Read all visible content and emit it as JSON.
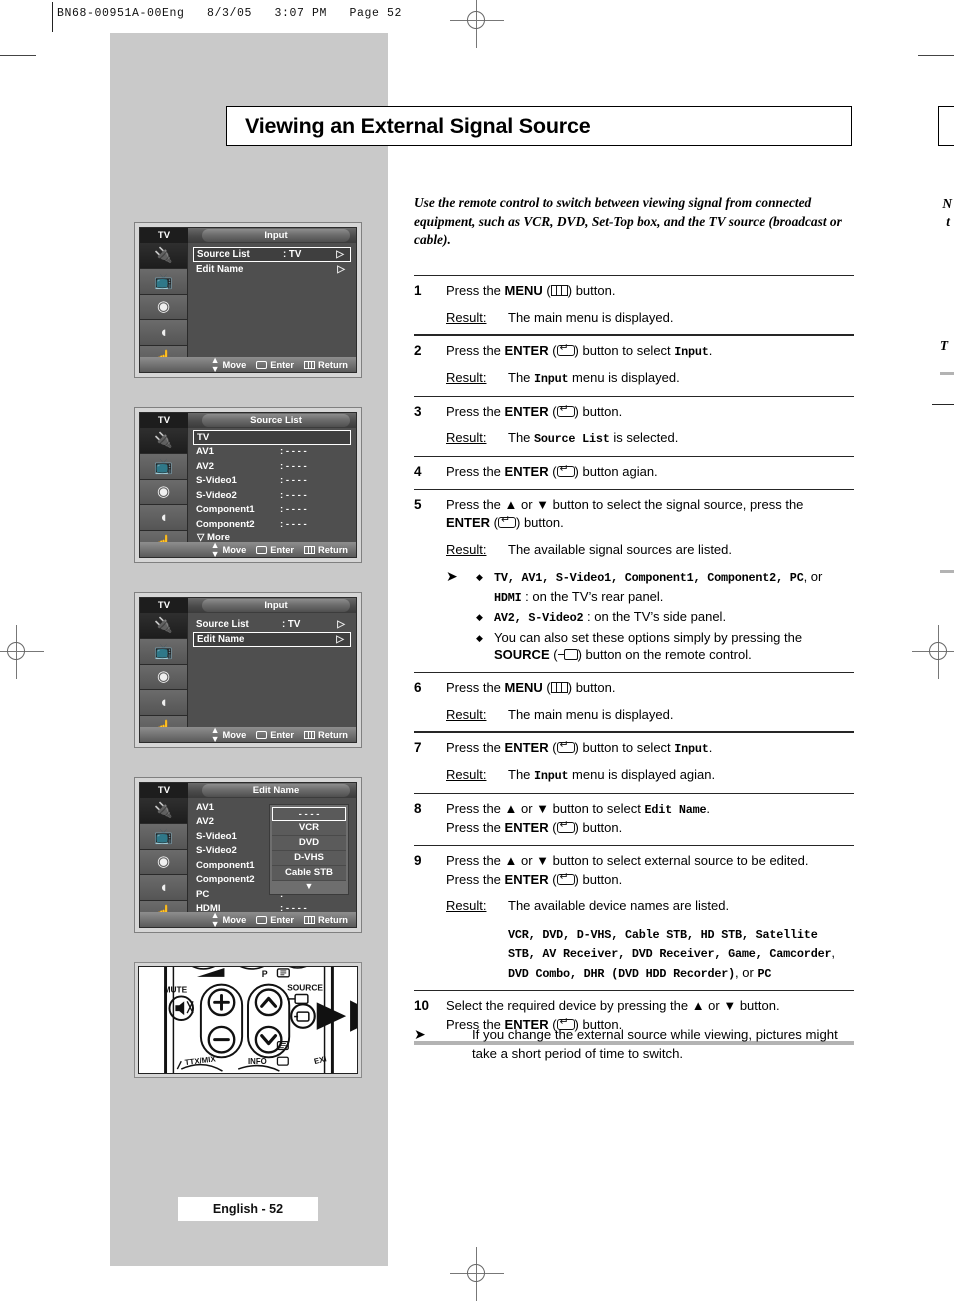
{
  "print_header": "BN68-00951A-00Eng   8/3/05   3:07 PM   Page 52",
  "title": "Viewing an External Signal Source",
  "intro": "Use the remote control to switch between viewing signal from connected equipment, such as VCR, DVD, Set-Top box, and the TV source (broadcast or cable).",
  "page_footer": "English - 52",
  "labels": {
    "result": "Result:",
    "move": "Move",
    "enter": "Enter",
    "return": "Return"
  },
  "steps": [
    {
      "num": "1",
      "lines": [
        "Press the ",
        "MENU",
        " (",
        "menu-icon",
        ") button."
      ],
      "text_before": "Press the ",
      "bold": "MENU",
      "icon": "menu-icon",
      "text_after": ") button.",
      "result": "The main menu is displayed."
    },
    {
      "num": "2",
      "text_before": "Press the ",
      "bold": "ENTER",
      "icon": "enter-icon",
      "text_after": ") button to select ",
      "mono_tail": "Input",
      "period": ".",
      "result_pre": "The ",
      "result_mono": "Input",
      "result_post": " menu is displayed."
    },
    {
      "num": "3",
      "text_before": "Press the ",
      "bold": "ENTER",
      "icon": "enter-icon",
      "text_after": ") button.",
      "result_pre": "The ",
      "result_mono": "Source List",
      "result_post": " is selected."
    },
    {
      "num": "4",
      "text_before": "Press the ",
      "bold": "ENTER",
      "icon": "enter-icon",
      "text_after": ") button agian."
    },
    {
      "num": "5",
      "line1_a": "Press the ▲ or ▼ button to select the signal source, press the",
      "line2_bold": "ENTER",
      "line2_after": ") button.",
      "result": "The available signal sources are listed.",
      "bullets": [
        {
          "mono_list": "TV, AV1, S-Video1, Component1, Component2, PC",
          "tail_or": ", or",
          "mono_second": "HDMI",
          "tail2": " : on the TV’s rear panel."
        },
        {
          "mono_list": "AV2, S-Video2",
          "tail2": " : on the TV’s side panel."
        },
        {
          "plain1": "You can also set these options simply by pressing the",
          "bold2": "SOURCE",
          "tail3": ") button on the remote control."
        }
      ]
    },
    {
      "num": "6",
      "text_before": "Press the ",
      "bold": "MENU",
      "icon": "menu-icon",
      "text_after": ") button.",
      "result": "The main menu is displayed."
    },
    {
      "num": "7",
      "text_before": "Press the ",
      "bold": "ENTER",
      "icon": "enter-icon",
      "text_after": ") button to select ",
      "mono_tail": "Input",
      "period": ".",
      "result_pre": "The ",
      "result_mono": "Input",
      "result_post": " menu is displayed agian."
    },
    {
      "num": "8",
      "line1_pre": "Press the ▲ or ▼ button to select ",
      "line1_mono": "Edit Name",
      "line1_post": ".",
      "line2_pre": "Press the ",
      "line2_bold": "ENTER",
      "line2_after": ") button."
    },
    {
      "num": "9",
      "line1": "Press the ▲ or ▼ button to select external source to be edited.",
      "line2_pre": "Press the ",
      "line2_bold": "ENTER",
      "line2_after": ") button.",
      "result": "The available device names are listed.",
      "devices_line1_mono": "VCR, DVD, D-VHS, Cable STB, HD STB, Satellite",
      "devices_line2_mono": "STB, AV Receiver, DVD Receiver, Game, Camcorder",
      "devices_line2_tail": ",",
      "devices_line3_mono": "DVD Combo, DHR (DVD HDD Recorder)",
      "devices_line3_mid": ", or ",
      "devices_line3_end": "PC"
    },
    {
      "num": "10",
      "line1": "Select the required device by pressing the ▲ or ▼ button.",
      "line2_pre": "Press the ",
      "line2_bold": "ENTER",
      "line2_after": ") button."
    }
  ],
  "tip": "If you change the external source while viewing, pictures might take a short period of time to switch.",
  "osd_panels": [
    {
      "id": "input-1",
      "tv_tag": "TV",
      "title": "Input",
      "rows": [
        {
          "label": "Source List",
          "value": ": TV",
          "chevron": "▷",
          "selected": true
        },
        {
          "label": "Edit Name",
          "value": "",
          "chevron": "▷",
          "selected": false
        }
      ]
    },
    {
      "id": "source-list",
      "tv_tag": "TV",
      "title": "Source List",
      "rows": [
        {
          "label": "TV",
          "value": "",
          "chevron": "",
          "selected": true
        },
        {
          "label": "AV1",
          "value": ": - - - -",
          "chevron": "",
          "selected": false
        },
        {
          "label": "AV2",
          "value": ": - - - -",
          "chevron": "",
          "selected": false
        },
        {
          "label": "S-Video1",
          "value": ": - - - -",
          "chevron": "",
          "selected": false
        },
        {
          "label": "S-Video2",
          "value": ": - - - -",
          "chevron": "",
          "selected": false
        },
        {
          "label": "Component1",
          "value": ": - - - -",
          "chevron": "",
          "selected": false
        },
        {
          "label": "Component2",
          "value": ": - - - -",
          "chevron": "",
          "selected": false
        }
      ],
      "more": "▽ More"
    },
    {
      "id": "input-2",
      "tv_tag": "TV",
      "title": "Input",
      "rows": [
        {
          "label": "Source List",
          "value": ": TV",
          "chevron": "▷",
          "selected": false
        },
        {
          "label": "Edit Name",
          "value": "",
          "chevron": "▷",
          "selected": true
        }
      ]
    },
    {
      "id": "edit-name",
      "tv_tag": "TV",
      "title": "Edit Name",
      "rows": [
        {
          "label": "AV1",
          "value": "",
          "chevron": "",
          "selected": false
        },
        {
          "label": "AV2",
          "value": "",
          "chevron": "",
          "selected": false
        },
        {
          "label": "S-Video1",
          "value": ":",
          "chevron": "",
          "selected": false
        },
        {
          "label": "S-Video2",
          "value": ":",
          "chevron": "",
          "selected": false
        },
        {
          "label": "Component1",
          "value": ":",
          "chevron": "",
          "selected": false
        },
        {
          "label": "Component2",
          "value": ":",
          "chevron": "",
          "selected": false
        },
        {
          "label": "PC",
          "value": ": - - - -",
          "chevron": "",
          "selected": false
        },
        {
          "label": "HDMI",
          "value": ": - - - -",
          "chevron": "",
          "selected": false
        }
      ],
      "dropdown": {
        "items": [
          "- - - -",
          "VCR",
          "DVD",
          "D-VHS",
          "Cable STB"
        ],
        "selected_index": 0,
        "caret": "▼"
      }
    }
  ],
  "remote": {
    "mute_label": "MUTE",
    "p_label": "P",
    "source_label": "SOURCE",
    "ttx_label": "TTX/MIX",
    "info_label": "INFO",
    "plus": "+",
    "minus": "–",
    "up": "∧",
    "down": "∨"
  },
  "bleed": {
    "frag1": "N",
    "frag2": "t",
    "frag3": "T"
  }
}
